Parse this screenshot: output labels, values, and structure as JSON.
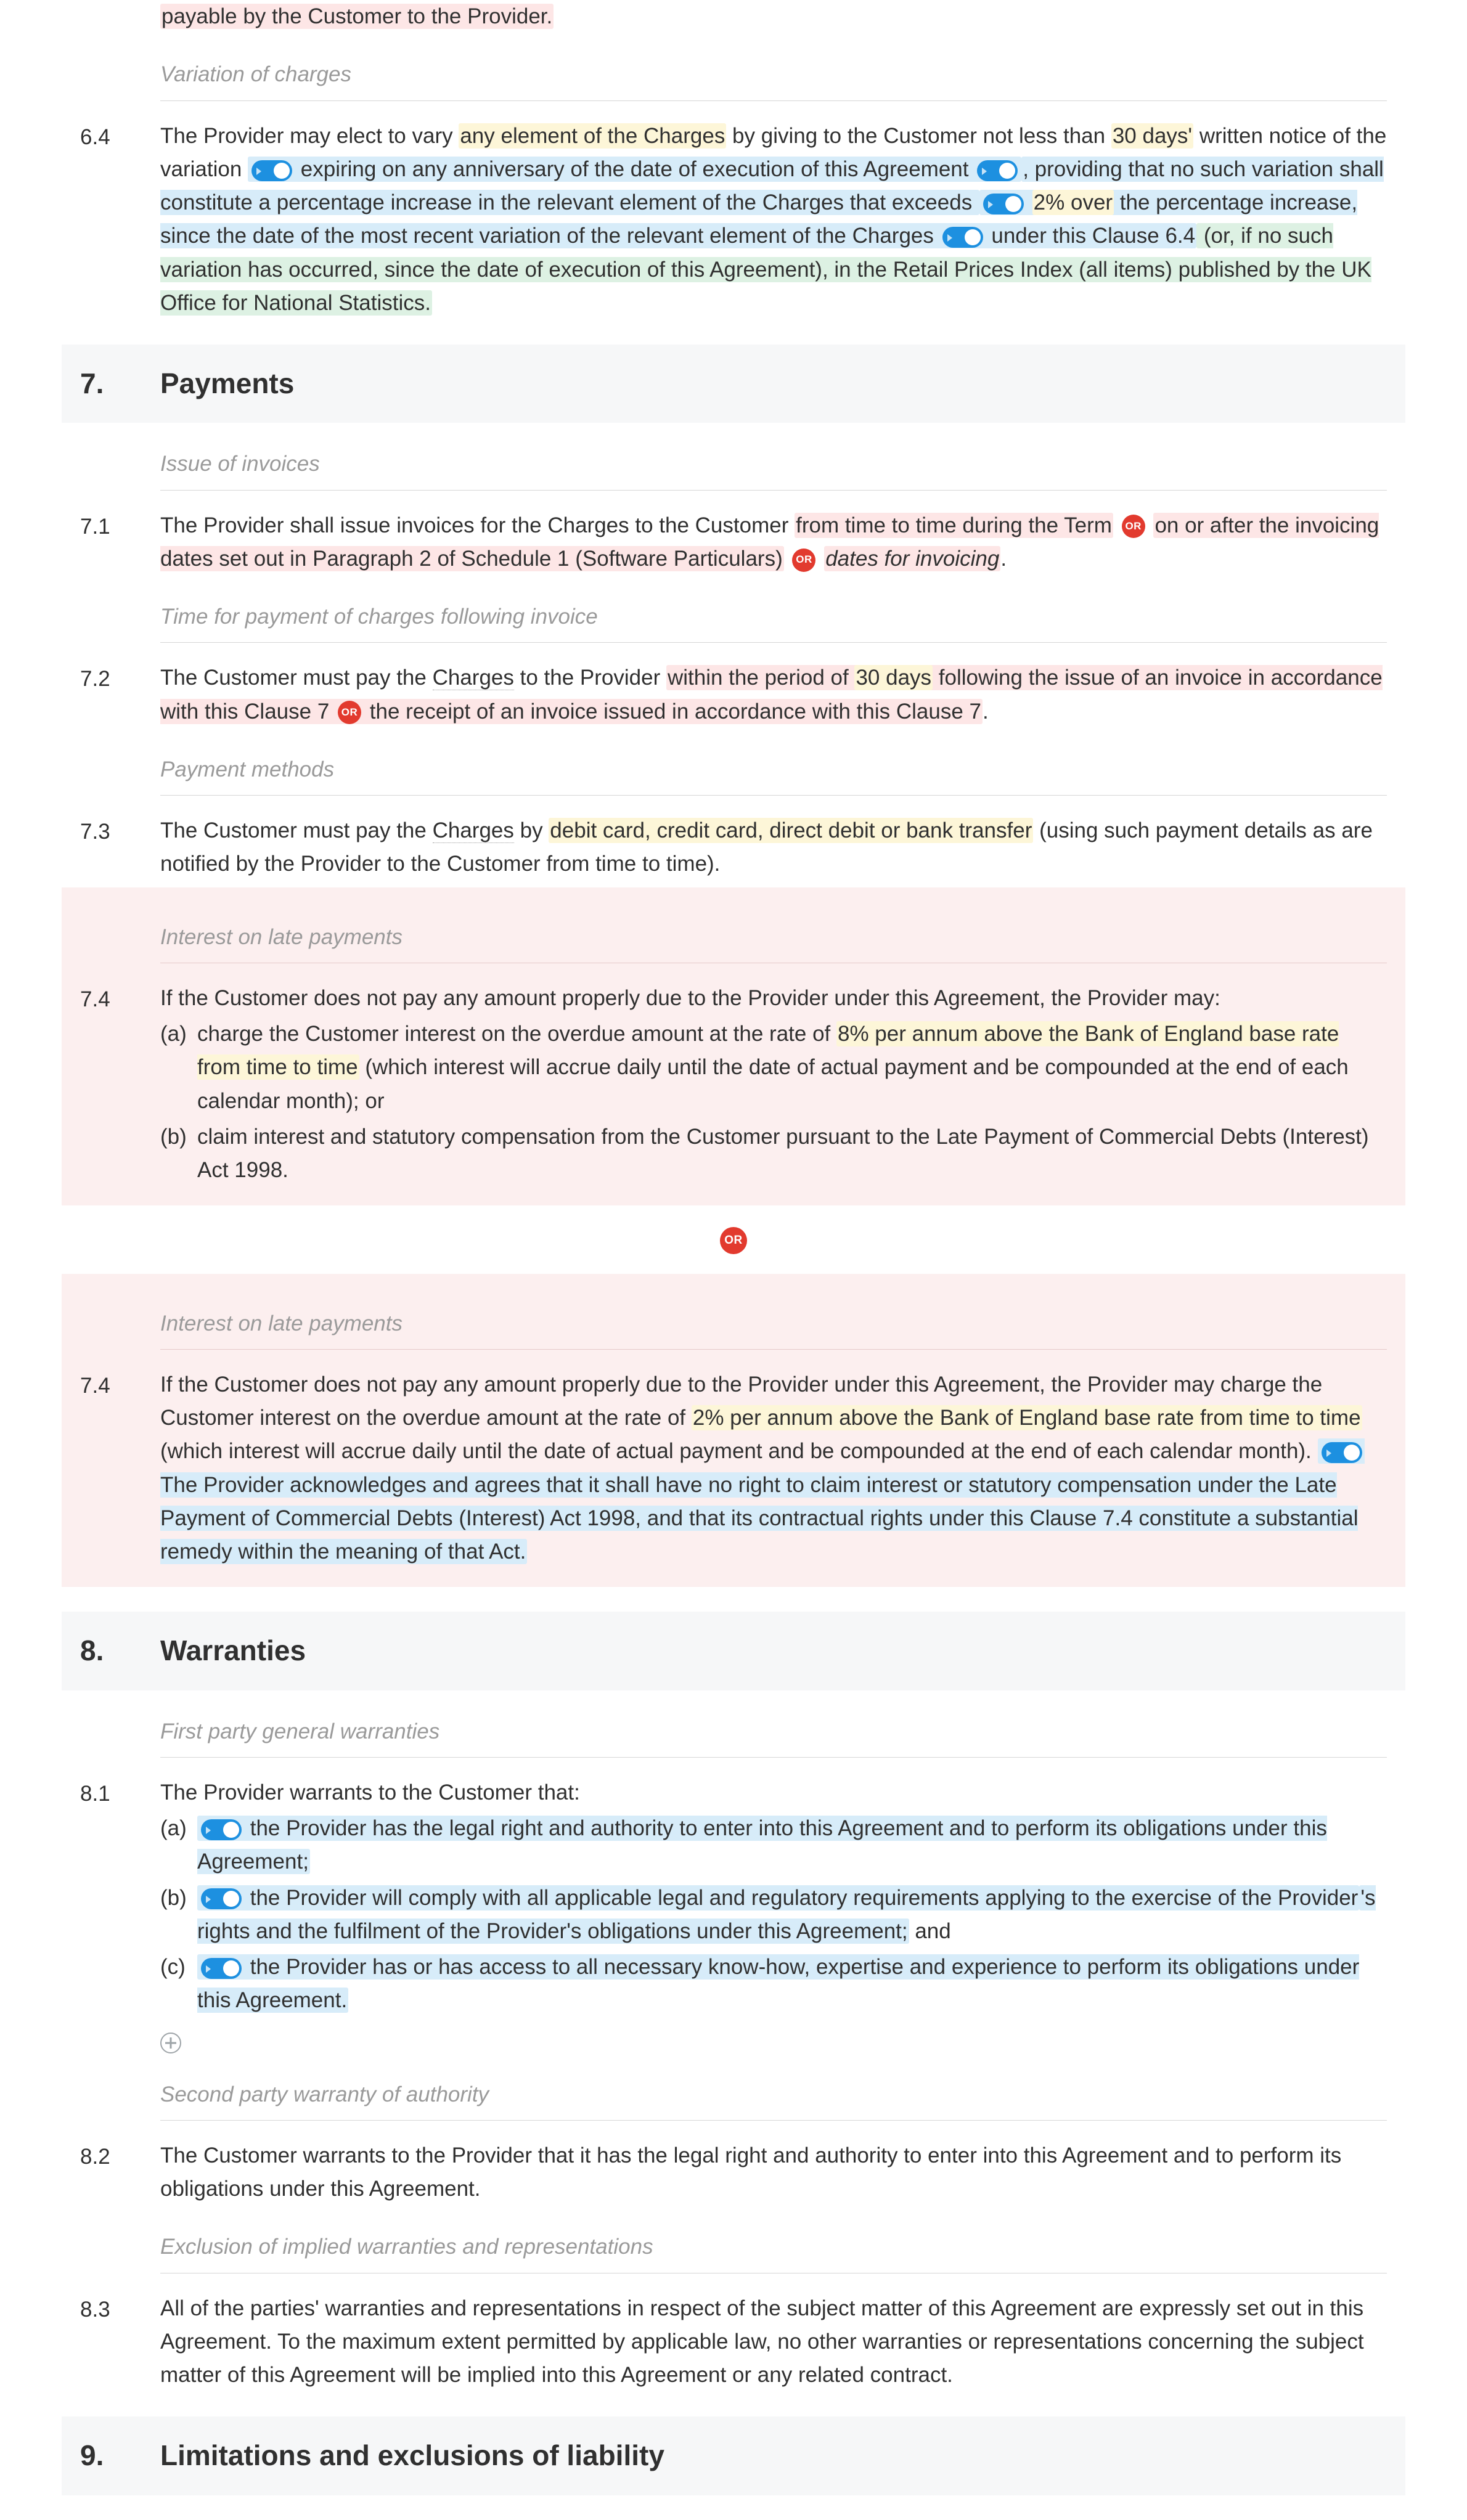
{
  "top": {
    "line": "payable by the Customer to the Provider."
  },
  "s6": {
    "sub_variation": "Variation of charges",
    "c64_num": "6.4",
    "c64_a": "The Provider may elect to vary ",
    "c64_b": "any element of the Charges",
    "c64_c": " by giving to the Customer not less than ",
    "c64_d": "30 days'",
    "c64_e": " written notice of the variation ",
    "c64_f": "expiring on any anniversary of the date of execution of this Agreement",
    "c64_g": ", providing that no such variation shall constitute a percentage increase in the relevant element of the Charges that exceeds ",
    "c64_h": "2% over",
    "c64_i": " the percentage increase, since the date of the most recent variation of the relevant element of the Charges ",
    "c64_j": "under this Clause 6.4",
    "c64_k": " (or, if no such variation has occurred, since the date of execution of this Agreement), in the Retail Prices Index (all items) published by the UK Office for National Statistics."
  },
  "s7": {
    "num": "7.",
    "title": "Payments",
    "sub_issue": "Issue of invoices",
    "c71_num": "7.1",
    "c71_a": "The Provider shall issue invoices for the Charges to the Customer ",
    "c71_b": "from time to time during the Term",
    "c71_c": "on or after the invoicing dates set out in Paragraph 2 of Schedule 1 (Software Particulars)",
    "c71_d": "dates for invoicing",
    "c71_dot": ".",
    "sub_time": "Time for payment of charges following invoice",
    "c72_num": "7.2",
    "c72_a": "The Customer must pay the ",
    "c72_ch": "Charges",
    "c72_b": " to the Provider ",
    "c72_c": "within the period of ",
    "c72_d": "30 days",
    "c72_e": " following ",
    "c72_f": "the issue of an invoice in accordance with this Clause 7",
    "c72_g": "the receipt of an invoice issued in accordance with this Clause 7",
    "sub_method": "Payment methods",
    "c73_num": "7.3",
    "c73_a": "The Customer must pay the ",
    "c73_ch": "Charges",
    "c73_b": " by ",
    "c73_c": "debit card, credit card, direct debit or bank transfer",
    "c73_d": " (using such payment details as are notified by the Provider to the Customer from time to time).",
    "sub_interest": "Interest on late payments",
    "c74_num": "7.4",
    "c74_intro": "If the Customer does not pay any amount properly due to the Provider under this Agreement, the Provider may:",
    "c74_a_letter": "(a)",
    "c74_a_1": "charge the Customer interest on the overdue amount at the rate of ",
    "c74_a_2": "8% per annum above the Bank of England base rate from time to time",
    "c74_a_3": " (which interest will accrue daily until the date of actual payment and be compounded at the end of each calendar month); or",
    "c74_b_letter": "(b)",
    "c74_b": "claim interest and statutory compensation from the Customer pursuant to the Late Payment of Commercial Debts (Interest) Act 1998.",
    "or_label": "OR",
    "c74b_num": "7.4",
    "c74b_1": "If the Customer does not pay any amount properly due to the Provider under this Agreement, the Provider may charge the Customer interest on the overdue amount at the rate of ",
    "c74b_2": "2% per annum above the Bank of England base rate from time to time",
    "c74b_3": " (which interest will accrue daily until the date of actual payment and be compounded at the end of each calendar month). ",
    "c74b_4": "The Provider acknowledges and agrees that it shall have no right to claim interest or statutory compensation under the Late Payment of Commercial Debts (Interest) Act 1998, and that its contractual rights under this Clause 7.4 constitute a substantial remedy within the meaning of that Act."
  },
  "s8": {
    "num": "8.",
    "title": "Warranties",
    "sub_first": "First party general warranties",
    "c81_num": "8.1",
    "c81_intro": "The Provider warrants to the Customer that:",
    "a_letter": "(a)",
    "a_text": "the Provider has the legal right and authority to enter into this Agreement and to perform its obligations under this Agreement;",
    "b_letter": "(b)",
    "b_text_1": "the Provider will comply with all applicable legal and regulatory requirements applying to the exercise of the Provider",
    "b_text_2": "'s rights and the fulfilment of the Provider's obligations under this Agreement;",
    "b_text_3": " and",
    "c_letter": "(c)",
    "c_text": "the Provider has or has access to all necessary know-how, expertise and experience to perform its obligations under this Agreement.",
    "sub_second": "Second party warranty of authority",
    "c82_num": "8.2",
    "c82": "The Customer warrants to the Provider that it has the legal right and authority to enter into this Agreement and to perform its obligations under this Agreement.",
    "sub_excl": "Exclusion of implied warranties and representations",
    "c83_num": "8.3",
    "c83": "All of the parties' warranties and representations in respect of the subject matter of this Agreement are expressly set out in this Agreement. To the maximum extent permitted by applicable law, no other warranties or representations concerning the subject matter of this Agreement will be implied into this Agreement or any related contract."
  },
  "s9": {
    "num": "9.",
    "title": "Limitations and exclusions of liability"
  }
}
